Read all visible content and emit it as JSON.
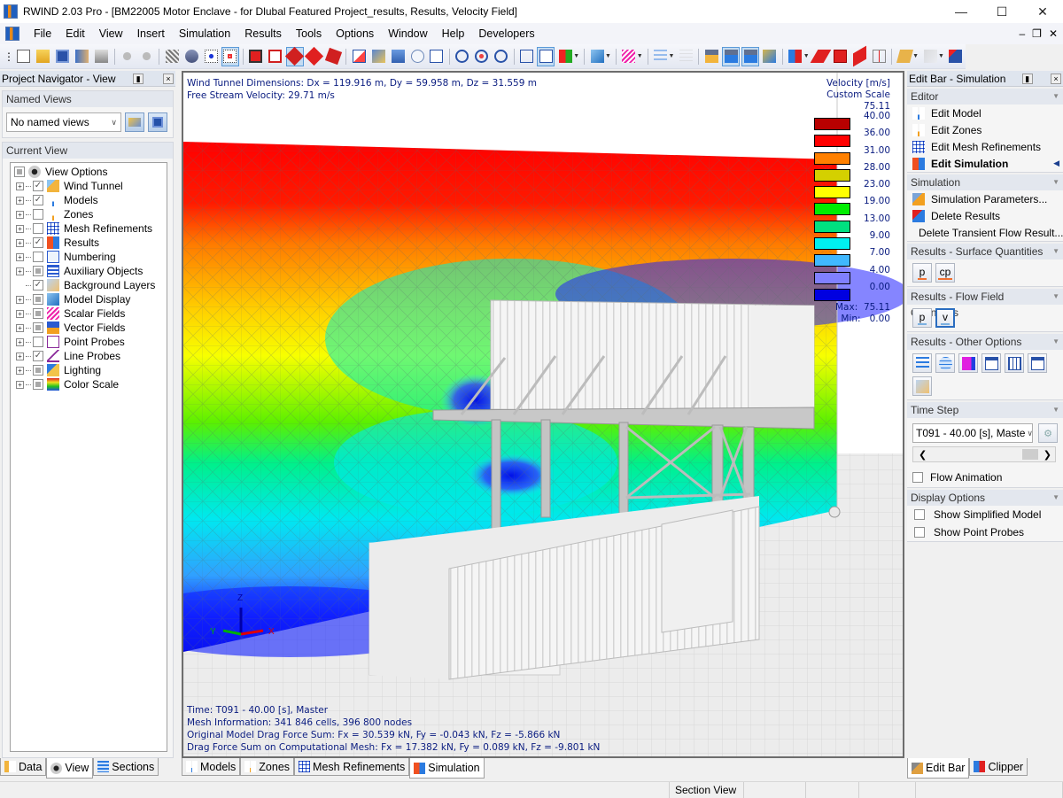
{
  "window": {
    "title": "RWIND 2.03 Pro - [BM22005 Motor Enclave - for Dlubal Featured Project_results, Results, Velocity Field]",
    "controls": [
      "minimize",
      "maximize",
      "close"
    ]
  },
  "menu": [
    "File",
    "Edit",
    "View",
    "Insert",
    "Simulation",
    "Results",
    "Tools",
    "Options",
    "Window",
    "Help",
    "Developers"
  ],
  "toolbar": {
    "buttons": [
      {
        "icon": "new-file-icon"
      },
      {
        "icon": "open-folder-icon"
      },
      {
        "icon": "save-icon"
      },
      {
        "icon": "model-data-icon"
      },
      {
        "icon": "print-icon"
      },
      {
        "sep": true
      },
      {
        "icon": "undo-icon"
      },
      {
        "icon": "redo-icon"
      },
      {
        "sep": true
      },
      {
        "icon": "display-mesh-icon"
      },
      {
        "icon": "view-options-icon"
      },
      {
        "icon": "grid-points-icon"
      },
      {
        "icon": "snap-grid-icon",
        "active": true
      },
      {
        "sep": true
      },
      {
        "icon": "select-box-icon"
      },
      {
        "icon": "deselect-box-icon"
      },
      {
        "icon": "rotate-view-icon",
        "active": true
      },
      {
        "icon": "rotate-red-icon"
      },
      {
        "icon": "rotate-alt-icon"
      },
      {
        "sep": true
      },
      {
        "icon": "move-view-icon"
      },
      {
        "icon": "render-icon"
      },
      {
        "icon": "previous-view-icon"
      },
      {
        "icon": "zoom-icon"
      },
      {
        "icon": "zoom-all-icon"
      },
      {
        "sep": true
      },
      {
        "icon": "orbit-select-icon"
      },
      {
        "icon": "orbit-center-icon"
      },
      {
        "icon": "orbit-icon"
      },
      {
        "sep": true
      },
      {
        "icon": "wireframe-icon"
      },
      {
        "icon": "isometric-icon",
        "active": true
      },
      {
        "icon": "axis-direction-icon",
        "dropdown": true
      },
      {
        "sep": true
      },
      {
        "icon": "solid-model-icon",
        "dropdown": true
      },
      {
        "sep": true
      },
      {
        "icon": "scalar-field-icon",
        "dropdown": true
      },
      {
        "sep": true
      },
      {
        "icon": "streamlines-icon",
        "dropdown": true,
        "disabled": true
      },
      {
        "icon": "isosurface-icon",
        "disabled": true
      },
      {
        "sep": true
      },
      {
        "icon": "show-wind-tunnel-icon"
      },
      {
        "icon": "show-models-icon",
        "active": true
      },
      {
        "icon": "show-zones-icon",
        "active": true
      },
      {
        "icon": "show-background-icon"
      },
      {
        "sep": true
      },
      {
        "icon": "clipping-box-icon",
        "dropdown": true
      },
      {
        "icon": "clip-plane-xy-icon"
      },
      {
        "icon": "clip-plane-xz-icon"
      },
      {
        "icon": "clip-plane-yz-icon"
      },
      {
        "icon": "clip-offset-icon"
      },
      {
        "sep": true
      },
      {
        "icon": "section-plane-icon",
        "dropdown": true
      },
      {
        "icon": "cut-tool-icon",
        "dropdown": true,
        "disabled": true
      },
      {
        "icon": "delete-cut-icon"
      }
    ]
  },
  "left_panel": {
    "title": "Project Navigator - View",
    "named_views": {
      "title": "Named Views",
      "selected": "No named views"
    },
    "current_view": {
      "title": "Current View",
      "items": [
        {
          "label": "View Options",
          "state": "partial",
          "root": true,
          "icon": "eye-icon"
        },
        {
          "label": "Wind Tunnel",
          "state": "checked",
          "icon": "wind-tunnel-icon"
        },
        {
          "label": "Models",
          "state": "checked",
          "icon": "models-icon"
        },
        {
          "label": "Zones",
          "state": "unchecked",
          "icon": "zones-icon"
        },
        {
          "label": "Mesh Refinements",
          "state": "unchecked",
          "icon": "mesh-refinements-icon"
        },
        {
          "label": "Results",
          "state": "checked",
          "icon": "results-icon"
        },
        {
          "label": "Numbering",
          "state": "unchecked",
          "icon": "numbering-icon"
        },
        {
          "label": "Auxiliary Objects",
          "state": "partial",
          "icon": "auxiliary-objects-icon"
        },
        {
          "label": "Background Layers",
          "state": "checked",
          "icon": "background-layers-icon",
          "leaf": true
        },
        {
          "label": "Model Display",
          "state": "partial",
          "icon": "model-display-icon"
        },
        {
          "label": "Scalar Fields",
          "state": "partial",
          "icon": "scalar-fields-icon"
        },
        {
          "label": "Vector Fields",
          "state": "partial",
          "icon": "vector-fields-icon"
        },
        {
          "label": "Point Probes",
          "state": "unchecked",
          "icon": "point-probes-icon"
        },
        {
          "label": "Line Probes",
          "state": "checked",
          "icon": "line-probes-icon"
        },
        {
          "label": "Lighting",
          "state": "partial",
          "icon": "lighting-icon"
        },
        {
          "label": "Color Scale",
          "state": "partial",
          "icon": "color-scale-icon"
        }
      ]
    },
    "tabs": [
      {
        "label": "Data",
        "icon": "data-tree-icon"
      },
      {
        "label": "View",
        "icon": "eye-icon",
        "active": true
      },
      {
        "label": "Sections",
        "icon": "sections-icon"
      }
    ]
  },
  "viewport": {
    "info_top": [
      "Wind Tunnel Dimensions: Dx = 119.916 m, Dy = 59.958 m, Dz = 31.559 m",
      "Free Stream Velocity: 29.71 m/s"
    ],
    "info_bottom": [
      "Time: T091 - 40.00 [s], Master",
      "Mesh Information: 341 846 cells, 396 800 nodes",
      "Original Model Drag Force Sum: Fx = 30.539 kN, Fy = -0.043 kN, Fz = -5.866 kN",
      "Drag Force Sum on Computational Mesh: Fx = 17.382 kN, Fy = 0.089 kN, Fz = -9.801 kN"
    ],
    "axes": {
      "x": "X",
      "y": "Y",
      "z": "Z"
    },
    "legend": {
      "title": "Velocity [m/s]",
      "subtitle": "Custom Scale",
      "top_value": "75.11",
      "bands": [
        {
          "color": "#b80000",
          "value": "40.00"
        },
        {
          "color": "#ff0000",
          "value": "36.00"
        },
        {
          "color": "#ff8000",
          "value": "31.00"
        },
        {
          "color": "#d4d000",
          "value": "28.00"
        },
        {
          "color": "#ffff00",
          "value": "23.00"
        },
        {
          "color": "#00ee00",
          "value": "19.00"
        },
        {
          "color": "#00e080",
          "value": "13.00"
        },
        {
          "color": "#00f0f0",
          "value": "9.00"
        },
        {
          "color": "#40b8ff",
          "value": "7.00"
        },
        {
          "color": "#8080ff",
          "value": "4.00"
        },
        {
          "color": "#0000e0",
          "value": "0.00"
        }
      ],
      "max_label": "Max:",
      "max_value": "75.11",
      "min_label": "Min:",
      "min_value": "0.00"
    },
    "tabs": [
      {
        "label": "Models",
        "icon": "models-icon"
      },
      {
        "label": "Zones",
        "icon": "zones-icon"
      },
      {
        "label": "Mesh Refinements",
        "icon": "mesh-refinements-icon"
      },
      {
        "label": "Simulation",
        "icon": "simulation-icon",
        "active": true
      }
    ]
  },
  "right_panel": {
    "title": "Edit Bar - Simulation",
    "editor": {
      "title": "Editor",
      "items": [
        {
          "label": "Edit Model",
          "icon": "models-icon"
        },
        {
          "label": "Edit Zones",
          "icon": "zones-icon"
        },
        {
          "label": "Edit Mesh Refinements",
          "icon": "mesh-refinements-icon"
        },
        {
          "label": "Edit Simulation",
          "icon": "simulation-icon",
          "active": true
        }
      ]
    },
    "simulation": {
      "title": "Simulation",
      "items": [
        {
          "label": "Simulation Parameters...",
          "icon": "simulation-parameters-icon"
        },
        {
          "label": "Delete Results",
          "icon": "delete-results-icon"
        },
        {
          "label": "Delete Transient Flow Result...",
          "icon": "delete-transient-icon"
        }
      ]
    },
    "surface_quantities": {
      "title": "Results - Surface Quantities",
      "buttons": [
        {
          "label": "p",
          "icon": "surface-pressure-icon"
        },
        {
          "label": "cp",
          "icon": "pressure-coefficient-icon"
        }
      ]
    },
    "flow_field_quantities": {
      "title": "Results - Flow Field Quantities",
      "buttons": [
        {
          "label": "p",
          "icon": "flow-pressure-icon"
        },
        {
          "label": "v",
          "icon": "flow-velocity-icon",
          "active": true
        }
      ]
    },
    "other_options": {
      "title": "Results - Other Options",
      "buttons": [
        {
          "icon": "streamlines-icon"
        },
        {
          "icon": "isosurfaces-icon"
        },
        {
          "icon": "flow-direction-icon"
        },
        {
          "icon": "graph-icon"
        },
        {
          "icon": "line-probe-chart-icon"
        },
        {
          "icon": "report-icon"
        },
        {
          "icon": "background-layer-icon"
        }
      ]
    },
    "time_step": {
      "title": "Time Step",
      "selected": "T091 - 40.00 [s], Maste",
      "flow_animation_label": "Flow Animation",
      "flow_animation": false
    },
    "display_options": {
      "title": "Display Options",
      "items": [
        {
          "label": "Show Simplified Model",
          "checked": false
        },
        {
          "label": "Show Point Probes",
          "checked": false
        }
      ]
    },
    "tabs": [
      {
        "label": "Edit Bar",
        "icon": "tools-icon",
        "active": true
      },
      {
        "label": "Clipper",
        "icon": "clipper-icon"
      }
    ]
  },
  "statusbar": {
    "cells": [
      "",
      "Section View",
      "",
      "",
      "",
      ""
    ]
  }
}
